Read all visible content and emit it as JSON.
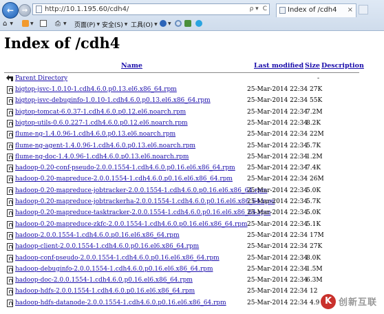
{
  "browser": {
    "address": "http://10.1.195.60/cdh4/",
    "tab_title": "Index of /cdh4",
    "address_search_glyph": "ρ ▾",
    "address_refresh_glyph": "C",
    "tab_close": "×",
    "commands": {
      "page": "页面(P)",
      "safety": "安全(S)",
      "tools": "工具(O)"
    }
  },
  "page": {
    "title": "Index of /cdh4",
    "columns": {
      "name": "Name",
      "last_modified": "Last modified",
      "size": "Size",
      "description": "Description"
    },
    "parent": {
      "name": "Parent Directory",
      "size": "-"
    },
    "files": [
      {
        "name": "bigtop-jsvc-1.0.10-1.cdh4.6.0.p0.13.el6.x86_64.rpm",
        "modified": "25-Mar-2014 22:34",
        "size": "27K"
      },
      {
        "name": "bigtop-jsvc-debuginfo-1.0.10-1.cdh4.6.0.p0.13.el6.x86_64.rpm",
        "modified": "25-Mar-2014 22:34",
        "size": "55K"
      },
      {
        "name": "bigtop-tomcat-6.0.37-1.cdh4.6.0.p0.12.el6.noarch.rpm",
        "modified": "25-Mar-2014 22:34",
        "size": "7.2M"
      },
      {
        "name": "bigtop-utils-0.6.0.227-1.cdh4.6.0.p0.12.el6.noarch.rpm",
        "modified": "25-Mar-2014 22:34",
        "size": "8.2K"
      },
      {
        "name": "flume-ng-1.4.0.96-1.cdh4.6.0.p0.13.el6.noarch.rpm",
        "modified": "25-Mar-2014 22:34",
        "size": "22M"
      },
      {
        "name": "flume-ng-agent-1.4.0.96-1.cdh4.6.0.p0.13.el6.noarch.rpm",
        "modified": "25-Mar-2014 22:34",
        "size": "5.7K"
      },
      {
        "name": "flume-ng-doc-1.4.0.96-1.cdh4.6.0.p0.13.el6.noarch.rpm",
        "modified": "25-Mar-2014 22:34",
        "size": "1.2M"
      },
      {
        "name": "hadoop-0.20-conf-pseudo-2.0.0.1554-1.cdh4.6.0.p0.16.el6.x86_64.rpm",
        "modified": "25-Mar-2014 22:34",
        "size": "7.4K"
      },
      {
        "name": "hadoop-0.20-mapreduce-2.0.0.1554-1.cdh4.6.0.p0.16.el6.x86_64.rpm",
        "modified": "25-Mar-2014 22:34",
        "size": "26M"
      },
      {
        "name": "hadoop-0.20-mapreduce-jobtracker-2.0.0.1554-1.cdh4.6.0.p0.16.el6.x86_64.rpm",
        "modified": "25-Mar-2014 22:34",
        "size": "5.0K"
      },
      {
        "name": "hadoop-0.20-mapreduce-jobtrackerha-2.0.0.1554-1.cdh4.6.0.p0.16.el6.x86_64.rpm",
        "modified": "25-Mar-2014 22:34",
        "size": "5.7K"
      },
      {
        "name": "hadoop-0.20-mapreduce-tasktracker-2.0.0.1554-1.cdh4.6.0.p0.16.el6.x86_64.rpm",
        "modified": "25-Mar-2014 22:34",
        "size": "5.0K"
      },
      {
        "name": "hadoop-0.20-mapreduce-zkfc-2.0.0.1554-1.cdh4.6.0.p0.16.el6.x86_64.rpm",
        "modified": "25-Mar-2014 22:34",
        "size": "5.1K"
      },
      {
        "name": "hadoop-2.0.0.1554-1.cdh4.6.0.p0.16.el6.x86_64.rpm",
        "modified": "25-Mar-2014 22:34",
        "size": "17M"
      },
      {
        "name": "hadoop-client-2.0.0.1554-1.cdh4.6.0.p0.16.el6.x86_64.rpm",
        "modified": "25-Mar-2014 22:34",
        "size": "27K"
      },
      {
        "name": "hadoop-conf-pseudo-2.0.0.1554-1.cdh4.6.0.p0.16.el6.x86_64.rpm",
        "modified": "25-Mar-2014 22:34",
        "size": "8.0K"
      },
      {
        "name": "hadoop-debuginfo-2.0.0.1554-1.cdh4.6.0.p0.16.el6.x86_64.rpm",
        "modified": "25-Mar-2014 22:34",
        "size": "1.5M"
      },
      {
        "name": "hadoop-doc-2.0.0.1554-1.cdh4.6.0.p0.16.el6.x86_64.rpm",
        "modified": "25-Mar-2014 22:34",
        "size": "6.3M"
      },
      {
        "name": "hadoop-hdfs-2.0.0.1554-1.cdh4.6.0.p0.16.el6.x86_64.rpm",
        "modified": "25-Mar-2014 22:34",
        "size": "12"
      },
      {
        "name": "hadoop-hdfs-datanode-2.0.0.1554-1.cdh4.6.0.p0.16.el6.x86_64.rpm",
        "modified": "25-Mar-2014 22:34",
        "size": "4.9"
      }
    ]
  },
  "watermark": {
    "logo": "K",
    "text": "创新互联"
  }
}
